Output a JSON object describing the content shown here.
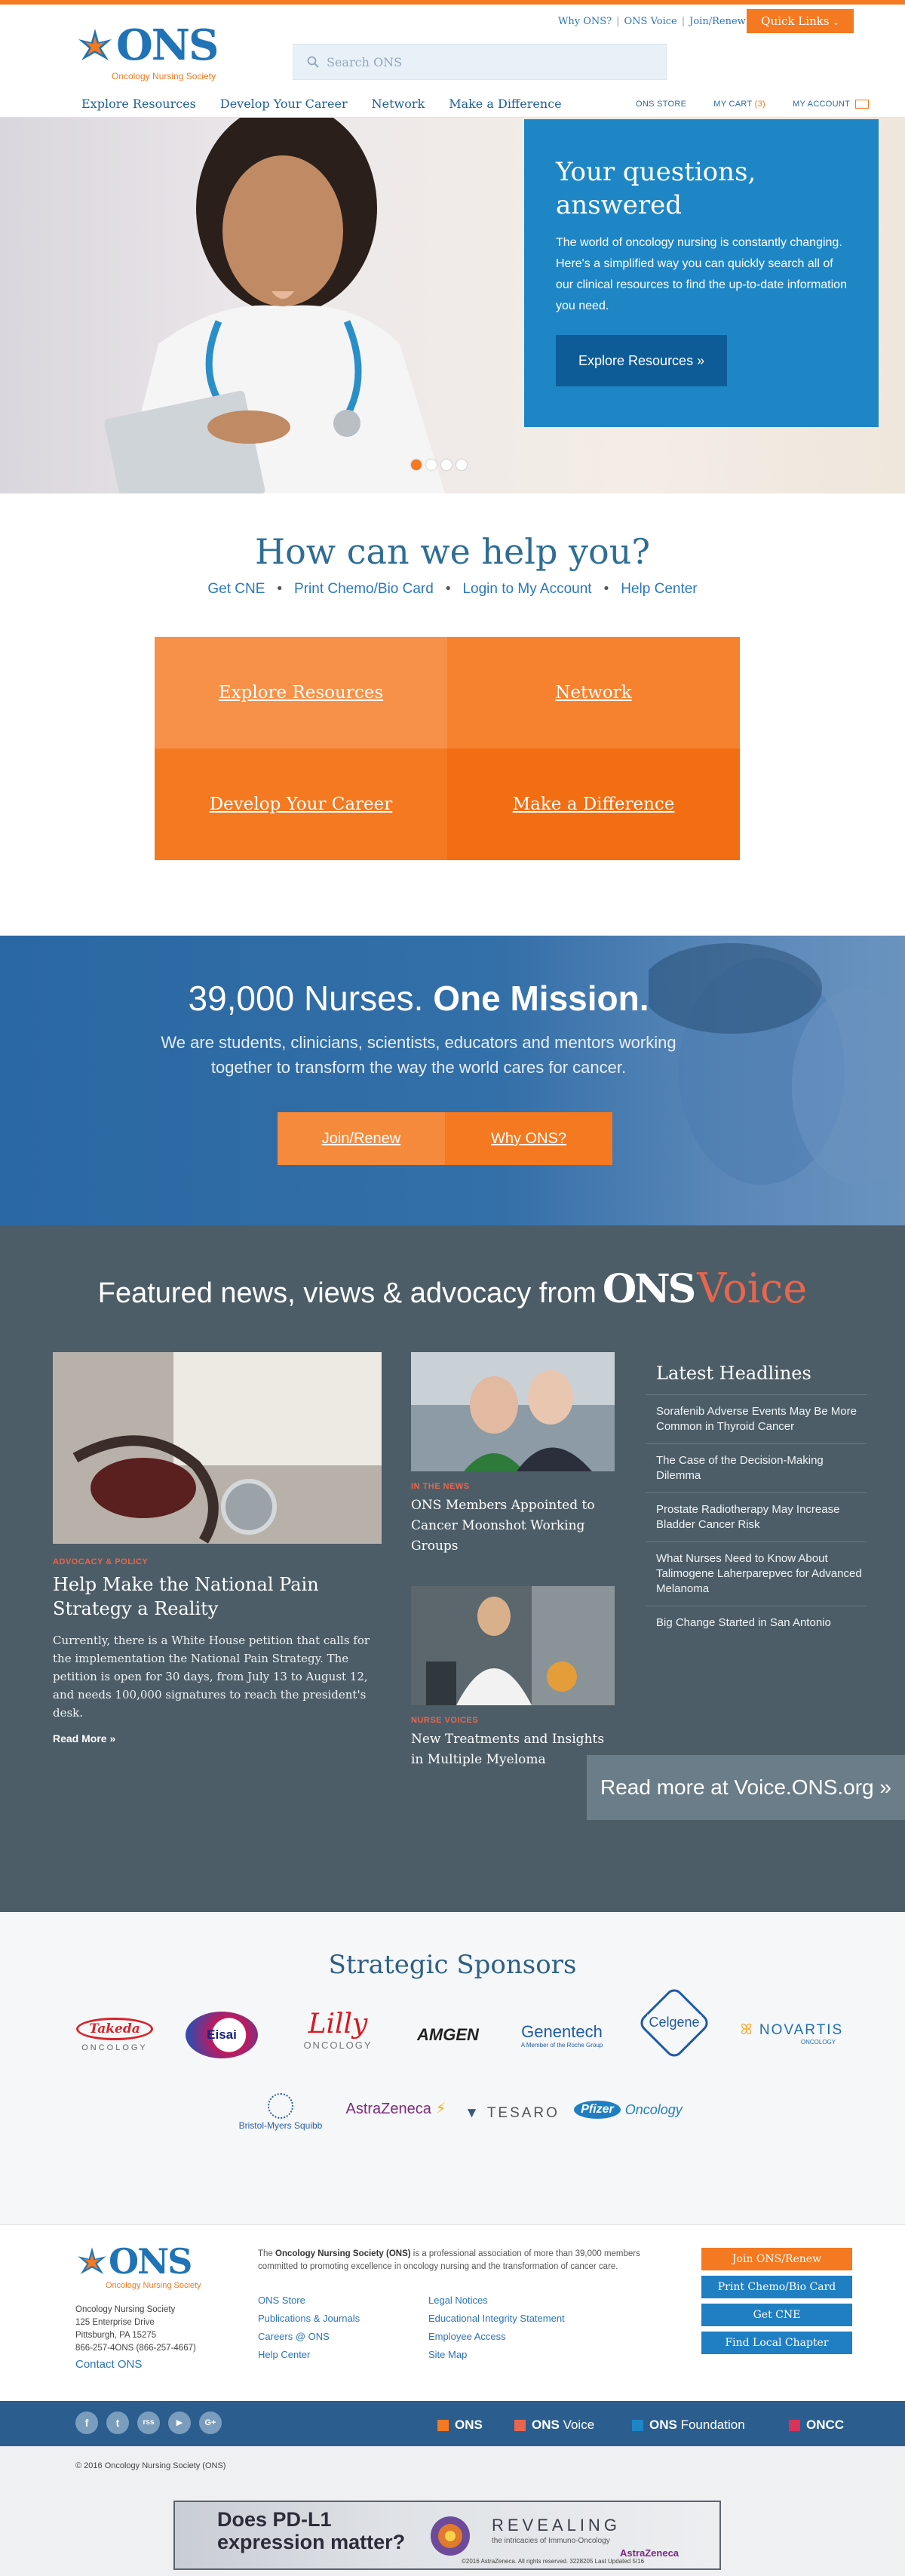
{
  "header": {
    "logo_text": "ONS",
    "logo_sub": "Oncology Nursing Society",
    "toplinks": [
      "Why ONS?",
      "ONS Voice",
      "Join/Renew"
    ],
    "quick_links": "Quick Links",
    "search_placeholder": "Search ONS",
    "nav": [
      "Explore Resources",
      "Develop Your Career",
      "Network",
      "Make a Difference"
    ],
    "util": {
      "store": "ONS STORE",
      "cart": "MY CART",
      "cart_count": "(3)",
      "account": "MY ACCOUNT"
    }
  },
  "hero": {
    "title": "Your questions, answered",
    "text": "The world of oncology nursing is constantly changing. Here's a simplified way you can quickly search all of our clinical resources to find the up-to-date information you need.",
    "button": "Explore Resources »",
    "slide_count": 4,
    "active_slide": 1
  },
  "help": {
    "title": "How can we help you?",
    "links": [
      "Get CNE",
      "Print Chemo/Bio Card",
      "Login to My Account",
      "Help Center"
    ],
    "tiles": [
      "Explore Resources",
      "Network",
      "Develop Your Career",
      "Make a Difference"
    ]
  },
  "mission": {
    "title_plain": "39,000 Nurses.",
    "title_bold": "One Mission.",
    "text": "We are students, clinicians, scientists, educators and mentors working together to transform the way the world cares for cancer.",
    "btn1": "Join/Renew",
    "btn2": "Why ONS?"
  },
  "voice": {
    "title": "Featured news, views & advocacy from",
    "brand_ons": "ONS",
    "brand_voice": "Voice",
    "main": {
      "tag": "ADVOCACY & POLICY",
      "title": "Help Make the National Pain Strategy a Reality",
      "text": "Currently, there is a White House petition that calls for the implementation the National Pain Strategy. The petition is open for 30 days, from July 13 to August 12, and needs 100,000 signatures to reach the president's desk.",
      "more": "Read More »"
    },
    "second": {
      "tag": "IN THE NEWS",
      "title": "ONS Members Appointed to Cancer Moonshot Working Groups"
    },
    "third": {
      "tag": "NURSE VOICES",
      "title": "New Treatments and Insights in Multiple Myeloma"
    },
    "latest_title": "Latest Headlines",
    "headlines": [
      "Sorafenib Adverse Events May Be More Common in Thyroid Cancer",
      "The Case of the Decision-Making Dilemma",
      "Prostate Radiotherapy May Increase Bladder Cancer Risk",
      "What Nurses Need to Know About Talimogene Laherparepvec for Advanced Melanoma",
      "Big Change Started in San Antonio"
    ],
    "readmore": "Read more at Voice.ONS.org »"
  },
  "sponsors": {
    "title": "Strategic Sponsors",
    "names": [
      "Takeda",
      "ONCOLOGY",
      "Eisai",
      "Lilly",
      "ONCOLOGY",
      "AMGEN",
      "Genentech",
      "A Member of the Roche Group",
      "Celgene",
      "NOVARTIS",
      "ONCOLOGY",
      "Bristol-Myers Squibb",
      "AstraZeneca",
      "TESARO",
      "Pfizer",
      "Oncology"
    ]
  },
  "footer": {
    "address": [
      "Oncology Nursing Society",
      "125 Enterprise Drive",
      "Pittsburgh, PA 15275",
      "866-257-4ONS (866-257-4667)"
    ],
    "contact": "Contact ONS",
    "about_bold": "Oncology Nursing Society (ONS)",
    "about_pre": "The",
    "about_post": "is a professional association of more than 39,000 members committed to promoting excellence in oncology nursing and the transformation of cancer care.",
    "links_col1": [
      "ONS Store",
      "Publications & Journals",
      "Careers @ ONS",
      "Help Center"
    ],
    "links_col2": [
      "Legal Notices",
      "Educational Integrity Statement",
      "Employee Access",
      "Site Map"
    ],
    "buttons": [
      "Join ONS/Renew",
      "Print Chemo/Bio Card",
      "Get CNE",
      "Find Local Chapter"
    ],
    "social": [
      "f",
      "t",
      "rss",
      "▶",
      "G+"
    ],
    "brands": [
      {
        "prefix": "",
        "name": "ONS",
        "color": "#f47920"
      },
      {
        "prefix": "ONS",
        "name": "Voice",
        "color": "#e8664d"
      },
      {
        "prefix": "ONS",
        "name": "Foundation",
        "color": "#1f86c6"
      },
      {
        "prefix": "",
        "name": "ONCC",
        "color": "#d8335a"
      }
    ],
    "copyright": "© 2016 Oncology Nursing Society (ONS)"
  },
  "ad": {
    "headline": "Does PD-L1 expression matter?",
    "revealing": "REVEALING",
    "sub": "the intricacies of Immuno-Oncology",
    "brand": "AstraZeneca",
    "fine": "©2016 AstraZeneca. All rights reserved. 3228205 Last Updated 5/16"
  }
}
